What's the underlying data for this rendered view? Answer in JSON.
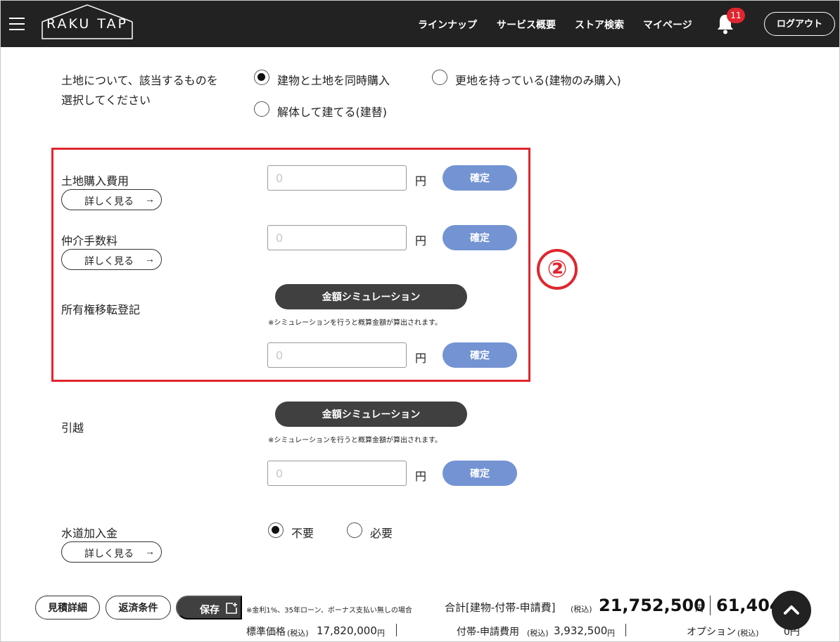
{
  "header": {
    "logo": "RAKU TAP",
    "nav": [
      "ラインナップ",
      "サービス概要",
      "ストア検索",
      "マイページ"
    ],
    "notification_count": "11",
    "logout_label": "ログアウト",
    "icons": {
      "menu": "hamburger-icon",
      "bell": "bell-icon"
    }
  },
  "land_question": {
    "label_line1": "土地について、該当するものを",
    "label_line2": "選択してください",
    "options": [
      {
        "label": "建物と土地を同時購入",
        "selected": true
      },
      {
        "label": "更地を持っている(建物のみ購入)",
        "selected": false
      },
      {
        "label": "解体して建てる(建替)",
        "selected": false
      }
    ]
  },
  "common": {
    "detail_label": "詳しく見る",
    "detail_arrow": "→",
    "yen": "円",
    "confirm": "確定",
    "simulation": "金額シミュレーション",
    "simulation_note": "※シミュレーションを行うと概算金額が算出されます。",
    "amount_placeholder": "0"
  },
  "fields": {
    "land_purchase": {
      "label": "土地購入費用",
      "value": ""
    },
    "brokerage": {
      "label": "仲介手数料",
      "value": ""
    },
    "ownership_transfer": {
      "label": "所有権移転登記",
      "value": ""
    },
    "moving": {
      "label": "引越",
      "value": ""
    }
  },
  "water": {
    "label": "水道加入金",
    "options": [
      {
        "label": "不要",
        "selected": true
      },
      {
        "label": "必要",
        "selected": false
      }
    ]
  },
  "annotation": {
    "marker": "②",
    "color": "#e0262e"
  },
  "footer": {
    "estimate_detail": "見積詳細",
    "repayment": "返済条件",
    "save": "保存",
    "note": "※金利1%、35年ローン、ボーナス支払い無しの場合",
    "total_label": "合計[建物-付帯-申請費]",
    "total_tax": "(税込)",
    "total_value": "21,752,500",
    "total_unit": "円",
    "monthly_value": "61,404",
    "standard_price_label": "標準価格",
    "standard_price_tax": "(税込)",
    "standard_price": "17,820,000",
    "standard_price_unit": "円",
    "ancillary_label": "付帯-申請費用",
    "ancillary_tax": "(税込)",
    "ancillary_value": "3,932,500",
    "ancillary_unit": "円",
    "option_label": "オプション",
    "option_tax": "(税込)",
    "option_value": "0円"
  },
  "colors": {
    "header_bg": "#222222",
    "confirm_blue": "#7393d3",
    "sim_dark": "#404040",
    "badge_red": "#e0262e"
  }
}
